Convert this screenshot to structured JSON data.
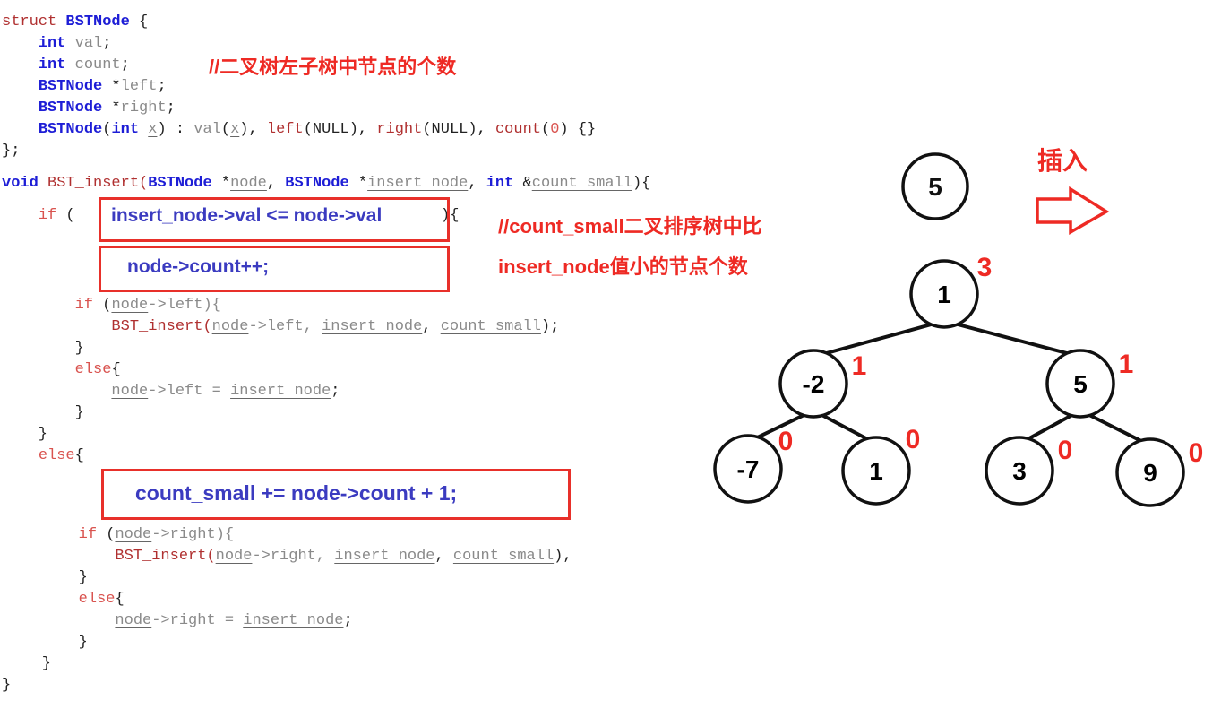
{
  "code_lines": [
    [
      [
        "struct ",
        "kd"
      ],
      [
        "BSTNode",
        "t"
      ],
      [
        " {",
        "p"
      ]
    ],
    [
      [
        "    ",
        "p"
      ],
      [
        "int",
        "t"
      ],
      [
        " val",
        "v"
      ],
      [
        ";",
        "p"
      ]
    ],
    [
      [
        "    ",
        "p"
      ],
      [
        "int",
        "t"
      ],
      [
        " count",
        "v"
      ],
      [
        ";",
        "p"
      ]
    ],
    [
      [
        "    ",
        "p"
      ],
      [
        "BSTNode",
        "t"
      ],
      [
        " *",
        "p"
      ],
      [
        "left",
        "v"
      ],
      [
        ";",
        "p"
      ]
    ],
    [
      [
        "    ",
        "p"
      ],
      [
        "BSTNode",
        "t"
      ],
      [
        " *",
        "p"
      ],
      [
        "right",
        "v"
      ],
      [
        ";",
        "p"
      ]
    ],
    [
      [
        "    ",
        "p"
      ],
      [
        "BSTNode",
        "t"
      ],
      [
        "(",
        "p"
      ],
      [
        "int",
        "t"
      ],
      [
        " ",
        "p"
      ],
      [
        "x",
        "u"
      ],
      [
        ") : ",
        "p"
      ],
      [
        "val",
        "v"
      ],
      [
        "(",
        "p"
      ],
      [
        "x",
        "u"
      ],
      [
        "), ",
        "p"
      ],
      [
        "left",
        "f"
      ],
      [
        "(NULL), ",
        "p"
      ],
      [
        "right",
        "f"
      ],
      [
        "(NULL), ",
        "p"
      ],
      [
        "count",
        "f"
      ],
      [
        "(",
        "p"
      ],
      [
        "0",
        "k"
      ],
      [
        ") {}",
        "p"
      ]
    ],
    [
      [
        "};",
        "p"
      ]
    ],
    [
      [
        "void",
        "t"
      ],
      [
        " BST_insert(",
        "f"
      ],
      [
        "BSTNode",
        "t"
      ],
      [
        " *",
        "p"
      ],
      [
        "node",
        "u"
      ],
      [
        ", ",
        "p"
      ],
      [
        "BSTNode",
        "t"
      ],
      [
        " *",
        "p"
      ],
      [
        "insert node",
        "u"
      ],
      [
        ", ",
        "p"
      ],
      [
        "int",
        "t"
      ],
      [
        " &",
        "p"
      ],
      [
        "count small",
        "u"
      ],
      [
        "){",
        "p"
      ]
    ],
    [
      [
        "    ",
        "p"
      ],
      [
        "if",
        "k"
      ],
      [
        " (",
        "p"
      ]
    ],
    [
      [
        "){",
        "p"
      ]
    ],
    [
      [
        "        ",
        "p"
      ],
      [
        "if",
        "k"
      ],
      [
        " (",
        "p"
      ],
      [
        "node",
        "u"
      ],
      [
        "->left){",
        "v"
      ]
    ],
    [
      [
        "            ",
        "p"
      ],
      [
        "BST_insert(",
        "f"
      ],
      [
        "node",
        "u"
      ],
      [
        "->left, ",
        "v"
      ],
      [
        "insert node",
        "u"
      ],
      [
        ", ",
        "p"
      ],
      [
        "count small",
        "u"
      ],
      [
        ");",
        "p"
      ]
    ],
    [
      [
        "        }",
        "p"
      ]
    ],
    [
      [
        "        ",
        "p"
      ],
      [
        "else",
        "k"
      ],
      [
        "{",
        "p"
      ]
    ],
    [
      [
        "            ",
        "p"
      ],
      [
        "node",
        "u"
      ],
      [
        "->left = ",
        "v"
      ],
      [
        "insert node",
        "u"
      ],
      [
        ";",
        "p"
      ]
    ],
    [
      [
        "        }",
        "p"
      ]
    ],
    [
      [
        "    }",
        "p"
      ]
    ],
    [
      [
        "    ",
        "p"
      ],
      [
        "else",
        "k"
      ],
      [
        "{",
        "p"
      ]
    ],
    [
      [
        "        ",
        "p"
      ],
      [
        "if",
        "k"
      ],
      [
        " (",
        "p"
      ],
      [
        "node",
        "u"
      ],
      [
        "->right){",
        "v"
      ]
    ],
    [
      [
        "            ",
        "p"
      ],
      [
        "BST_insert(",
        "f"
      ],
      [
        "node",
        "u"
      ],
      [
        "->right, ",
        "v"
      ],
      [
        "insert node",
        "u"
      ],
      [
        ", ",
        "p"
      ],
      [
        "count small",
        "u"
      ],
      [
        "),",
        "p"
      ]
    ],
    [
      [
        "        }",
        "p"
      ]
    ],
    [
      [
        "        ",
        "p"
      ],
      [
        "else",
        "k"
      ],
      [
        "{",
        "p"
      ]
    ],
    [
      [
        "            ",
        "p"
      ],
      [
        "node",
        "u"
      ],
      [
        "->right = ",
        "v"
      ],
      [
        "insert node",
        "u"
      ],
      [
        ";",
        "p"
      ]
    ],
    [
      [
        "        }",
        "p"
      ]
    ],
    [
      [
        "    }",
        "p"
      ]
    ],
    [
      [
        "}",
        "p"
      ]
    ]
  ],
  "highlights": {
    "condition": "insert_node->val <= node->val",
    "increment": "node->count++;",
    "accumulate": "count_small += node->count + 1;"
  },
  "notes": {
    "count_comment": "//二叉树左子树中节点的个数",
    "count_small_comment_1": "//count_small二叉排序树中比",
    "count_small_comment_2": "insert_node值小的节点个数",
    "insert_label": "插入"
  },
  "diagram": {
    "new_node": "5",
    "arrow_icon": "right-arrow-outline",
    "accent_color": "#ee2a24",
    "tree": [
      {
        "id": "root",
        "value": "1",
        "count": "3",
        "parent": null
      },
      {
        "id": "l",
        "value": "-2",
        "count": "1",
        "parent": "root"
      },
      {
        "id": "r",
        "value": "5",
        "count": "1",
        "parent": "root"
      },
      {
        "id": "ll",
        "value": "-7",
        "count": "0",
        "parent": "l"
      },
      {
        "id": "lr",
        "value": "1",
        "count": "0",
        "parent": "l"
      },
      {
        "id": "rl",
        "value": "3",
        "count": "0",
        "parent": "r"
      },
      {
        "id": "rr",
        "value": "9",
        "count": "0",
        "parent": "r"
      }
    ]
  }
}
